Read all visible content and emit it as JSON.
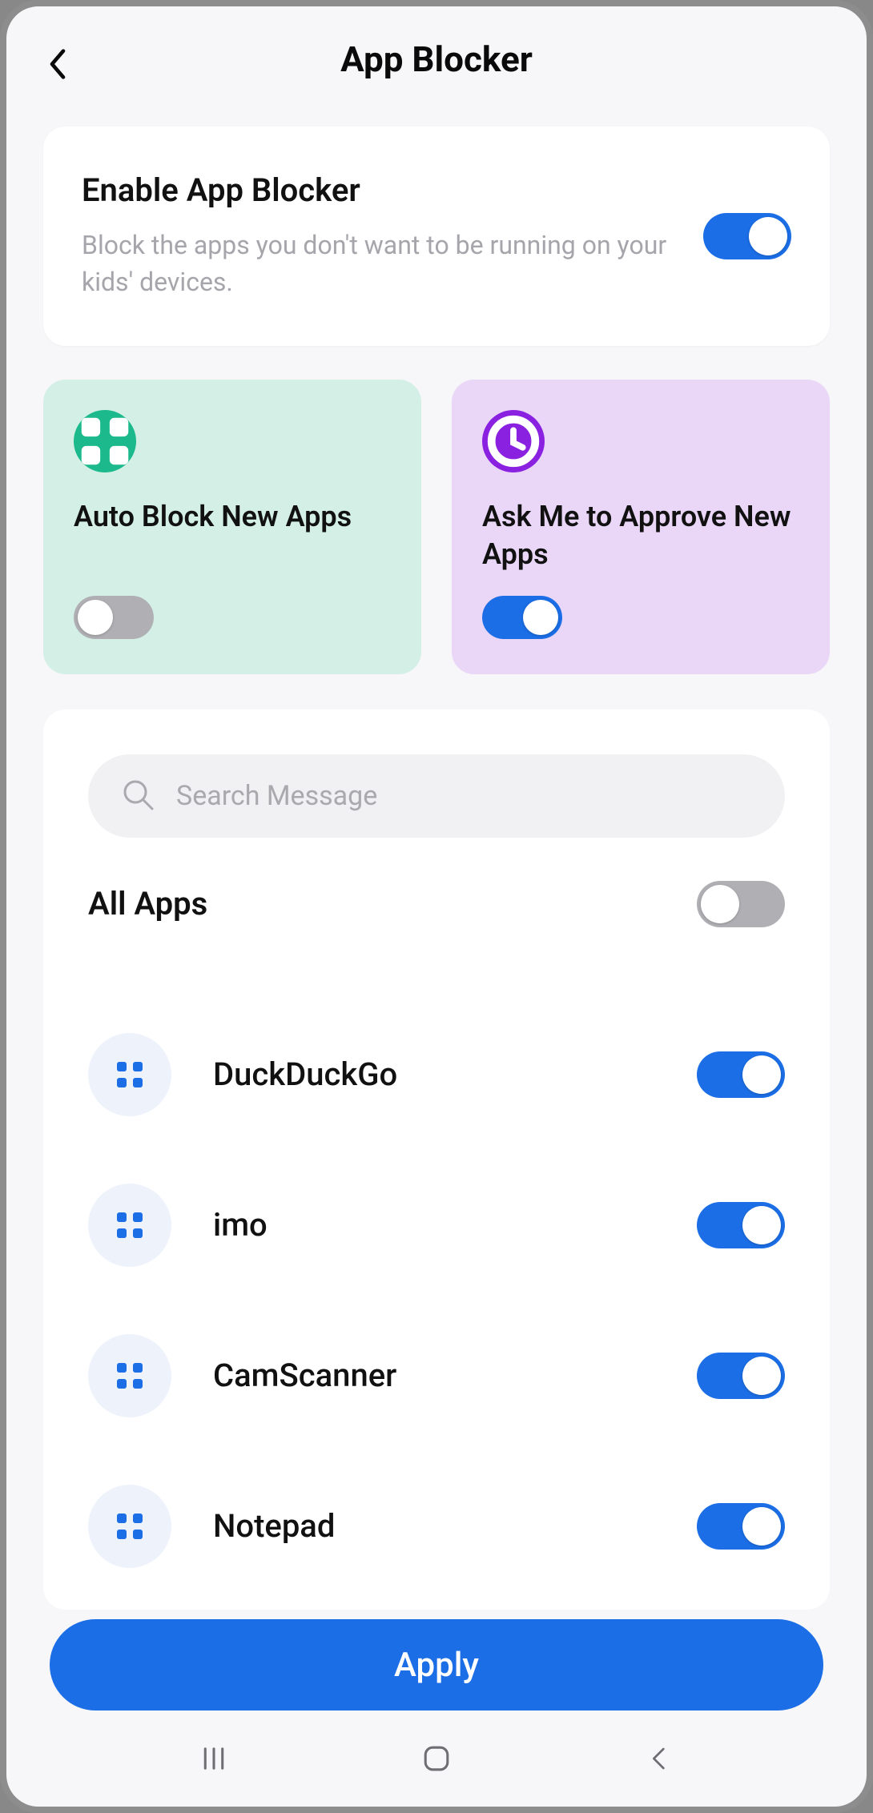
{
  "header": {
    "title": "App Blocker"
  },
  "enable": {
    "title": "Enable App Blocker",
    "subtitle": "Block the apps you don't want to be running on your kids' devices.",
    "on": true
  },
  "tiles": {
    "autoBlock": {
      "title": "Auto Block New Apps",
      "on": false
    },
    "askApprove": {
      "title": "Ask Me to Approve New Apps",
      "on": true
    }
  },
  "search": {
    "placeholder": "Search Message"
  },
  "allApps": {
    "label": "All Apps",
    "on": false
  },
  "apps": [
    {
      "name": "DuckDuckGo",
      "on": true
    },
    {
      "name": "imo",
      "on": true
    },
    {
      "name": "CamScanner",
      "on": true
    },
    {
      "name": "Notepad",
      "on": true
    }
  ],
  "apply": {
    "label": "Apply"
  }
}
